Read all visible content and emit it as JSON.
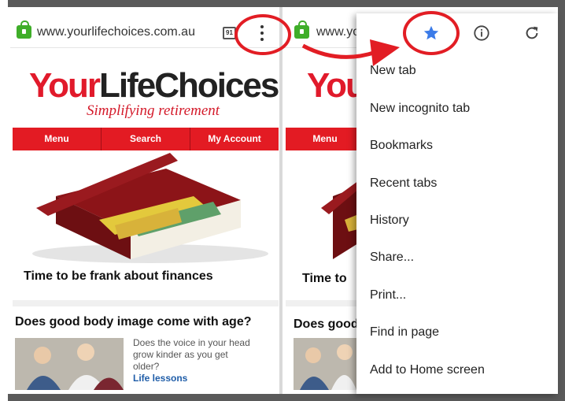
{
  "left_phone": {
    "url": "www.yourlifechoices.com.au",
    "tab_count": "91",
    "logo_your": "Your",
    "logo_rest": "LifeChoices",
    "tagline": "Simplifying retirement",
    "nav": [
      "Menu",
      "Search",
      "My Account"
    ],
    "headline_1": "Time to be frank about finances",
    "headline_2": "Does good body image come with age?",
    "blurb": "Does the voice in your head grow kinder as you get older?",
    "blurb_link": "Life lessons"
  },
  "right_phone": {
    "url": "www.yo",
    "logo_your": "You",
    "nav_first": "Menu",
    "headline_1": "Time to",
    "headline_2": "Does good"
  },
  "dropdown": {
    "icons": [
      "star-icon",
      "info-icon",
      "reload-icon"
    ],
    "items": [
      "New tab",
      "New incognito tab",
      "Bookmarks",
      "Recent tabs",
      "History",
      "Share...",
      "Print...",
      "Find in page",
      "Add to Home screen"
    ]
  },
  "colors": {
    "brand_red": "#e31b23",
    "annotation_red": "#e21d24",
    "star_blue": "#3b7be8",
    "lock_green": "#3fae29"
  }
}
